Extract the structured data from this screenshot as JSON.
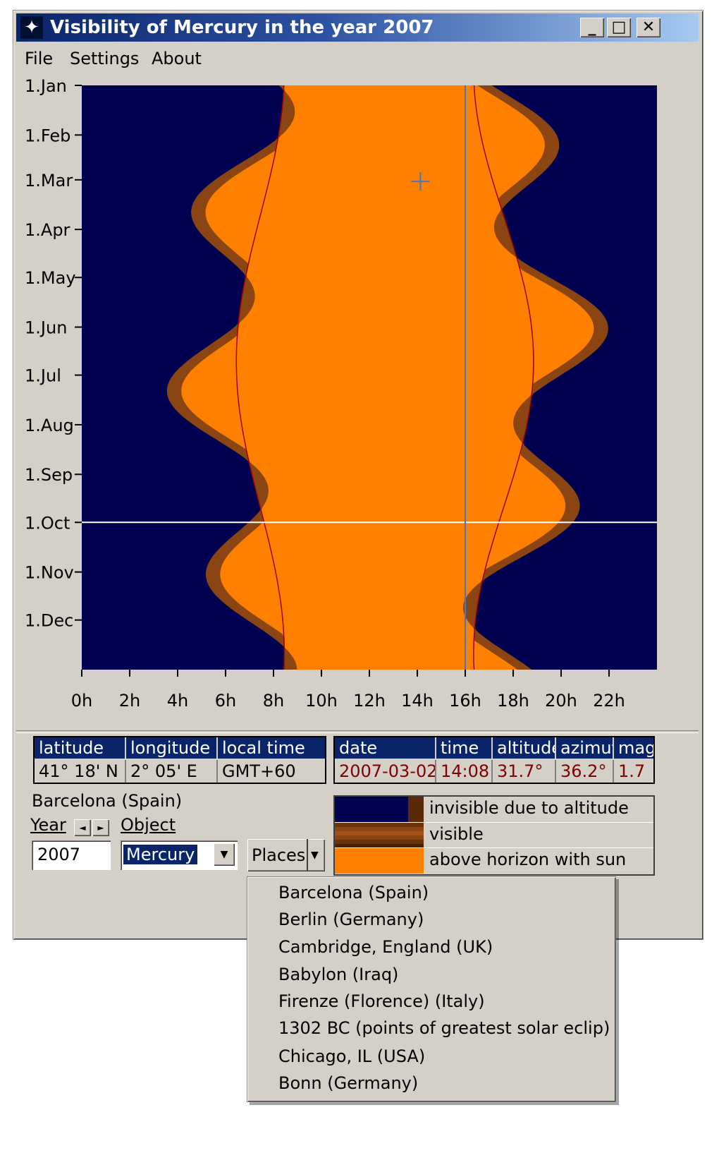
{
  "window": {
    "title": "Visibility of Mercury in the year 2007",
    "title_icon": "star-icon",
    "buttons": [
      "minimize-icon",
      "maximize-icon",
      "close-icon"
    ]
  },
  "menu": [
    "File",
    "Settings",
    "About"
  ],
  "chart_data": {
    "type": "heatmap",
    "y_labels": [
      "1.Jan",
      "1.Feb",
      "1.Mar",
      "1.Apr",
      "1.May",
      "1.Jun",
      "1.Jul",
      "1.Aug",
      "1.Sep",
      "1.Oct",
      "1.Nov",
      "1.Dec"
    ],
    "x_labels": [
      "0h",
      "2h",
      "4h",
      "6h",
      "8h",
      "10h",
      "12h",
      "14h",
      "16h",
      "18h",
      "20h",
      "22h"
    ],
    "x_range": [
      0,
      24
    ],
    "y_range_days": [
      0,
      365
    ],
    "cursor": {
      "hour": 16.0,
      "day": 273
    },
    "marker": {
      "hour": 14.13,
      "day": 60
    },
    "colors": {
      "invisible": "#000050",
      "visible": "#8b4513",
      "above_horizon_with_sun": "#ff8000",
      "sun_line": "#a00000",
      "cursor": "#3c7ad2",
      "hline": "#ffffff"
    }
  },
  "location_table": {
    "headers": [
      "latitude",
      "longitude",
      "local time"
    ],
    "values": [
      "41° 18' N",
      "2° 05' E",
      "GMT+60"
    ]
  },
  "info_table": {
    "headers": [
      "date",
      "time",
      "altitude",
      "azimut",
      "mag"
    ],
    "values": [
      "2007-03-02",
      "14:08",
      "31.7°",
      "36.2°",
      "1.7"
    ]
  },
  "place_label": "Barcelona (Spain)",
  "year_label": "Year",
  "object_label": "Object",
  "year_value": "2007",
  "object_value": "Mercury",
  "places_button": "Places",
  "legend": [
    {
      "label": "invisible due to altitude"
    },
    {
      "label": "visible"
    },
    {
      "label": "above horizon with sun"
    }
  ],
  "places_menu": [
    "Barcelona (Spain)",
    "Berlin (Germany)",
    "Cambridge, England (UK)",
    "Babylon (Iraq)",
    "Firenze (Florence) (Italy)",
    "1302 BC (points of greatest solar eclip)",
    "Chicago, IL (USA)",
    "Bonn (Germany)"
  ]
}
